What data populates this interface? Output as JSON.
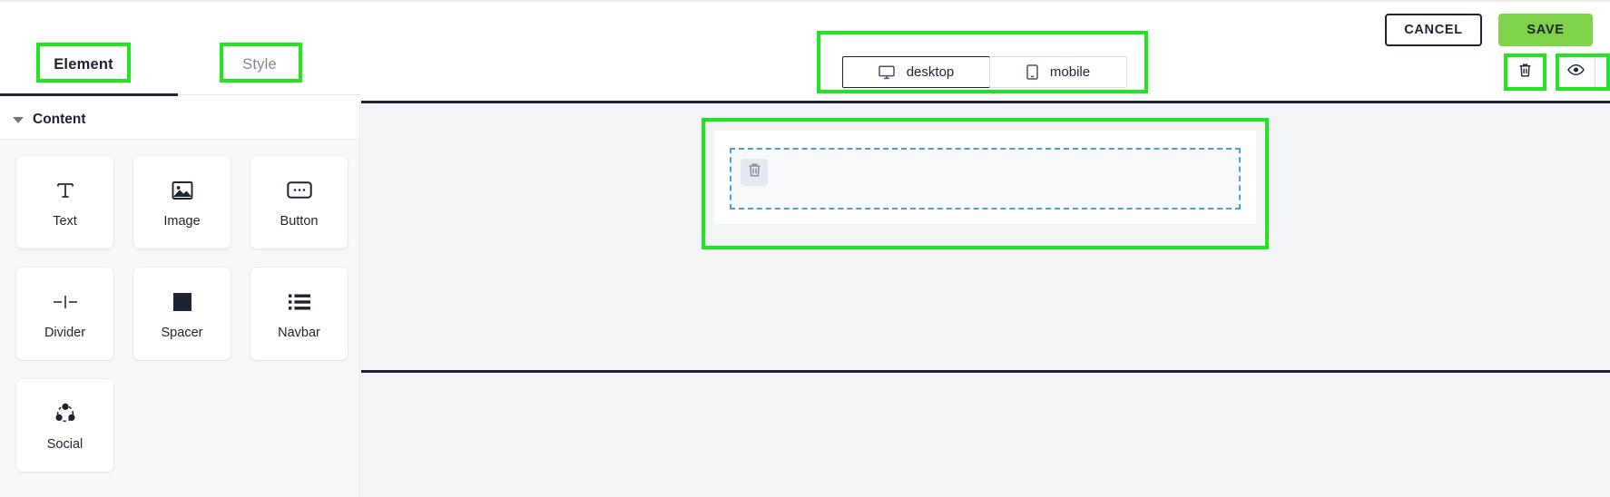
{
  "topbar": {
    "tabs": [
      {
        "label": "Element",
        "active": true
      },
      {
        "label": "Style",
        "active": false
      }
    ],
    "device_switch": [
      {
        "label": "desktop",
        "icon": "monitor-icon",
        "active": true
      },
      {
        "label": "mobile",
        "icon": "smartphone-icon",
        "active": false
      }
    ],
    "cancel_label": "CANCEL",
    "save_label": "SAVE",
    "save_bg": "#7ed348",
    "save_text_color": "#1d2333",
    "icon_buttons": [
      {
        "name": "delete-button",
        "icon": "trash-icon"
      },
      {
        "name": "preview-button",
        "icon": "eye-icon"
      }
    ]
  },
  "sidebar": {
    "section": {
      "title": "Content",
      "expanded": true,
      "caret": "caret-down-icon"
    },
    "elements": [
      {
        "label": "Text",
        "icon": "text-icon"
      },
      {
        "label": "Image",
        "icon": "image-icon"
      },
      {
        "label": "Button",
        "icon": "button-icon"
      },
      {
        "label": "Divider",
        "icon": "divider-icon"
      },
      {
        "label": "Spacer",
        "icon": "spacer-icon"
      },
      {
        "label": "Navbar",
        "icon": "navbar-icon"
      },
      {
        "label": "Social",
        "icon": "social-share-icon"
      }
    ]
  },
  "canvas": {
    "dropzone": {
      "border_color": "#4a9fd8",
      "style": "dashed",
      "trash_icon": "trash-icon"
    },
    "background": "#f3f4f5"
  },
  "annotations": {
    "color": "#20e520",
    "boxes": [
      "element-tab",
      "style-tab",
      "device-switch-group",
      "canvas-block",
      "delete-button",
      "preview-button"
    ]
  }
}
